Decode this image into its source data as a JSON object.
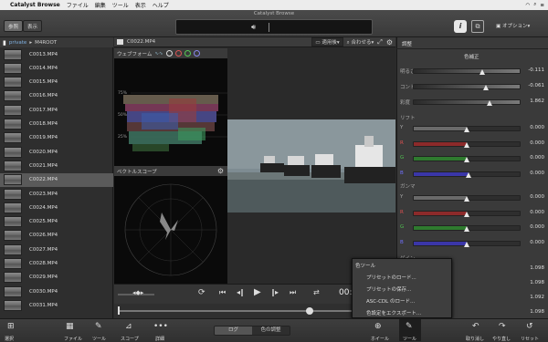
{
  "menubar": {
    "app": "Catalyst Browse",
    "items": [
      "ファイル",
      "編集",
      "ツール",
      "表示",
      "ヘルプ"
    ]
  },
  "window": {
    "title": "Catalyst Browse"
  },
  "toolbar": {
    "ref_label": "参照",
    "display_label": "表示",
    "options_label": "オプション▾"
  },
  "sidebar": {
    "crumb_parent": "private",
    "crumb_current": "M4ROOT",
    "clips": [
      "C0013.MP4",
      "C0014.MP4",
      "C0015.MP4",
      "C0016.MP4",
      "C0017.MP4",
      "C0018.MP4",
      "C0019.MP4",
      "C0020.MP4",
      "C0021.MP4",
      "C0022.MP4",
      "C0023.MP4",
      "C0024.MP4",
      "C0025.MP4",
      "C0026.MP4",
      "C0027.MP4",
      "C0028.MP4",
      "C0029.MP4",
      "C0030.MP4",
      "C0031.MP4"
    ],
    "selected_index": 9
  },
  "center": {
    "clip_name": "C0022.MP4",
    "view_select": "適用後",
    "fit_select": "合わせる",
    "waveform_title": "ウェブフォーム",
    "waveform_scale": [
      "75%",
      "50%",
      "25%"
    ],
    "vectorscope_title": "ベクトルスコープ",
    "timecode": "00:22"
  },
  "panel": {
    "header": "調整",
    "section": "色補正",
    "rows": [
      {
        "label": "明るさ",
        "value": "-0.111"
      },
      {
        "label": "コントラスト",
        "value": "-0.061"
      },
      {
        "label": "彩度",
        "value": "1.862"
      }
    ],
    "lift_title": "リフト",
    "lift": [
      {
        "label": "Y",
        "value": "0.000",
        "color": "#6a6a6a"
      },
      {
        "label": "R",
        "value": "0.000",
        "color": "#8c2a2a"
      },
      {
        "label": "G",
        "value": "0.000",
        "color": "#2f7a2f"
      },
      {
        "label": "B",
        "value": "0.000",
        "color": "#3a36a8"
      }
    ],
    "gamma_title": "ガンマ",
    "gamma": [
      {
        "label": "Y",
        "value": "0.000",
        "color": "#6a6a6a"
      },
      {
        "label": "R",
        "value": "0.000",
        "color": "#8c2a2a"
      },
      {
        "label": "G",
        "value": "0.000",
        "color": "#2f7a2f"
      },
      {
        "label": "B",
        "value": "0.000",
        "color": "#3a36a8"
      }
    ],
    "gain_title": "ゲイン",
    "gain_values": [
      "1.098",
      "1.098",
      "1.092",
      "1.098"
    ]
  },
  "menu": {
    "header": "色ツール",
    "items": [
      "プリセットのロード...",
      "プリセットの保存...",
      "ASC-CDL のロード...",
      "色設定をエクスポート..."
    ]
  },
  "bottombar": {
    "select": "選択",
    "file": "ファイル",
    "tool": "ツール",
    "scope": "スコープ",
    "detail": "詳細",
    "tab_log": "ログ",
    "tab_color": "色の調整",
    "wheel": "ホイール",
    "tools": "ツール",
    "undo": "取り消し",
    "redo": "やり直し",
    "reset": "リセット"
  }
}
